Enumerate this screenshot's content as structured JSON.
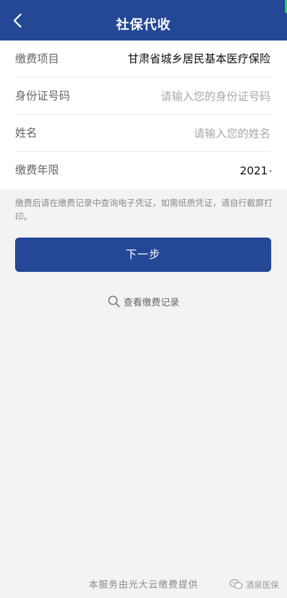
{
  "header": {
    "title": "社保代收",
    "back_icon": "chevron-left-icon",
    "color": "#244796"
  },
  "form": {
    "payment_item": {
      "label": "缴费项目",
      "value": "甘肃省城乡居民基本医疗保险"
    },
    "id_number": {
      "label": "身份证号码",
      "placeholder": "请输入您的身份证号码"
    },
    "name": {
      "label": "姓名",
      "placeholder": "请输入您的姓名"
    },
    "payment_year": {
      "label": "缴费年限",
      "value": "2021"
    }
  },
  "notice": "缴费后请在缴费记录中查询电子凭证，如需纸质凭证，请自行截屏打印。",
  "next_button": {
    "label": "下一步"
  },
  "record_link": {
    "label": "查看缴费记录",
    "icon": "search-icon"
  },
  "footer": "本服务由光大云缴费提供",
  "watermark": {
    "text": "酒泉医保",
    "icon": "wechat-icon"
  }
}
